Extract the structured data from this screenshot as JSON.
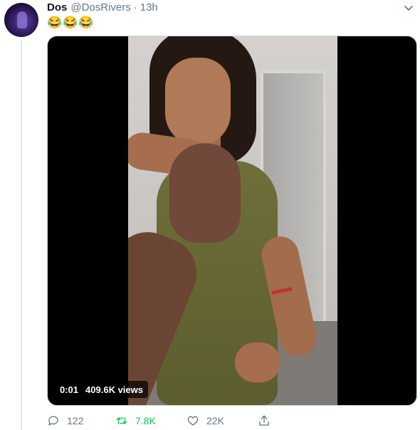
{
  "tweet": {
    "author_name": "Dos",
    "handle": "@DosRivers",
    "separator": "·",
    "time": "13h",
    "text": "😂😂😂"
  },
  "media": {
    "current_time": "0:01",
    "views": "409.6K views"
  },
  "actions": {
    "replies": "122",
    "retweets": "7.8K",
    "likes": "22K"
  },
  "colors": {
    "retweet_active": "#17bf63",
    "secondary_text": "#657786"
  }
}
